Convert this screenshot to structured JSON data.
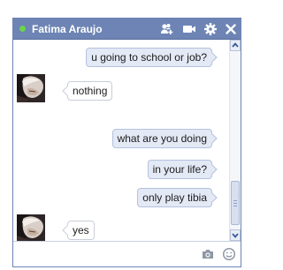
{
  "chat": {
    "contact_name": "Fatima Araujo",
    "status_color": "#6dd34a",
    "header_color": "#6d84b4",
    "header_icons": [
      "add-friend-icon",
      "video-call-icon",
      "gear-icon",
      "close-icon"
    ]
  },
  "messages": [
    {
      "direction": "out",
      "text": "u going to school or job?"
    },
    {
      "direction": "in",
      "text": "nothing"
    },
    {
      "direction": "out",
      "text": "what are you doing"
    },
    {
      "direction": "out",
      "text": "in your life?"
    },
    {
      "direction": "out",
      "text": "only play tibia"
    },
    {
      "direction": "in",
      "text": "yes"
    }
  ],
  "composer": {
    "value": "",
    "placeholder": "",
    "icons": [
      "camera-icon",
      "emoticon-icon"
    ]
  }
}
